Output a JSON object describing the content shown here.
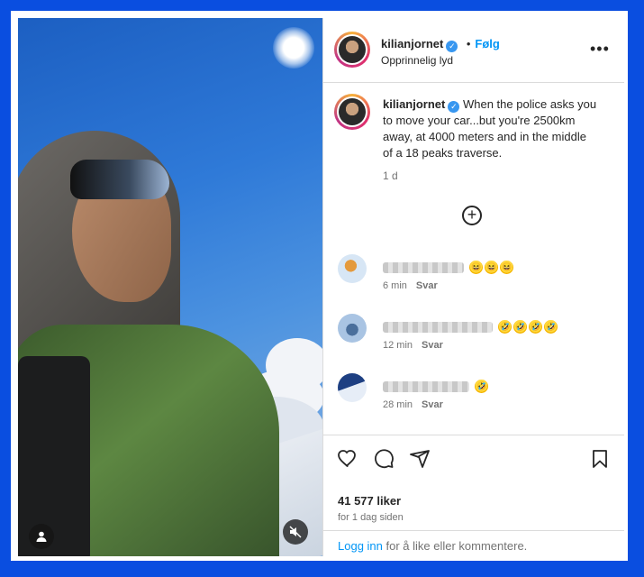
{
  "post": {
    "username": "kilianjornet",
    "follow_label": "Følg",
    "audio": "Opprinnelig lyd",
    "caption": "When the police asks you to move your car...but you're 2500km away, at 4000 meters and in the middle of a 18 peaks traverse.",
    "caption_age": "1 d",
    "likes": "41 577 liker",
    "posted": "for 1 dag siden",
    "login_link": "Logg inn",
    "login_rest": " for å like eller kommentere."
  },
  "comments": [
    {
      "time": "6 min",
      "reply": "Svar",
      "emoji": [
        "😆",
        "😆",
        "😆"
      ]
    },
    {
      "time": "12 min",
      "reply": "Svar",
      "emoji": [
        "🤣",
        "🤣",
        "🤣",
        "🤣"
      ]
    },
    {
      "time": "28 min",
      "reply": "Svar",
      "emoji": [
        "🤣"
      ]
    }
  ],
  "icons": {
    "verified": "verified-badge-icon",
    "more": "more-options-icon",
    "add_comment": "add-comment-icon",
    "like": "heart-icon",
    "comment": "comment-icon",
    "share": "share-icon",
    "save": "bookmark-icon",
    "mute": "muted-speaker-icon",
    "tag": "user-tag-icon"
  },
  "colors": {
    "accent": "#0095f6",
    "border": "#0a4ee0",
    "verified": "#3897f0"
  }
}
